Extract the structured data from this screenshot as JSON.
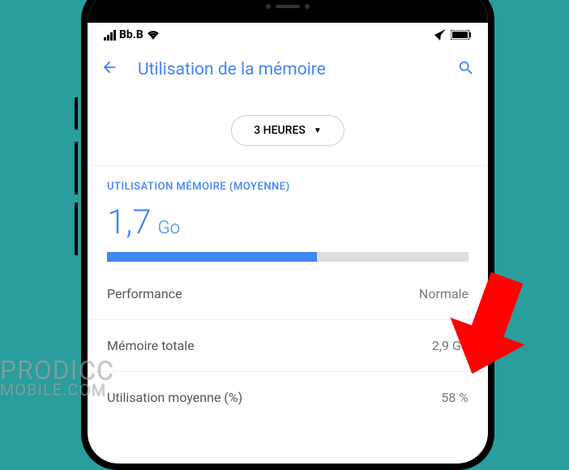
{
  "status": {
    "carrier": "Bb.B"
  },
  "appbar": {
    "title": "Utilisation de la mémoire"
  },
  "dropdown": {
    "selected": "3 HEURES"
  },
  "sectionLabel": "UTILISATION MÉMOIRE (MOYENNE)",
  "bigValue": {
    "num": "1,7",
    "unit": "Go"
  },
  "progressPercent": 58,
  "rows": {
    "performance": {
      "label": "Performance",
      "value": "Normale"
    },
    "totalMem": {
      "label": "Mémoire totale",
      "value": "2,9 Go"
    },
    "avgUse": {
      "label": "Utilisation moyenne (%)",
      "value": "58 %"
    }
  },
  "watermark": {
    "line1": "PRODICC",
    "line2": "MOBILE.COM"
  }
}
